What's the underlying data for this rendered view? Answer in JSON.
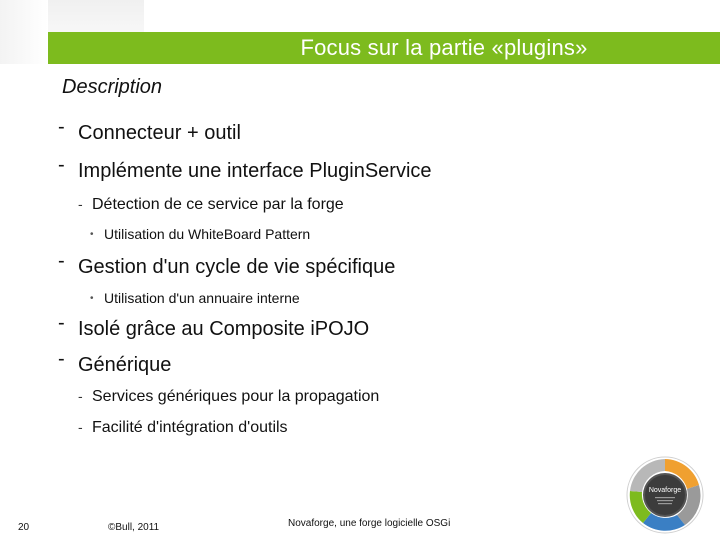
{
  "slide": {
    "title": "Focus sur la partie «plugins»",
    "section_label": "Description",
    "items": [
      {
        "level": 1,
        "marker": "-",
        "text": "Connecteur + outil"
      },
      {
        "level": 1,
        "marker": "-",
        "text": "Implémente une interface PluginService"
      },
      {
        "level": 2,
        "marker": "-",
        "text": "Détection de ce service par la forge"
      },
      {
        "level": 3,
        "marker": "•",
        "text": "Utilisation du WhiteBoard Pattern"
      },
      {
        "level": 1,
        "marker": "-",
        "text": "Gestion d'un cycle de vie spécifique"
      },
      {
        "level": 3,
        "marker": "•",
        "text": "Utilisation d'un annuaire interne"
      },
      {
        "level": 1,
        "marker": "-",
        "text": "Isolé grâce au Composite iPOJO"
      },
      {
        "level": 1,
        "marker": "-",
        "text": "Générique"
      },
      {
        "level": 2,
        "marker": "-",
        "text": "Services génériques pour la propagation"
      },
      {
        "level": 2,
        "marker": "-",
        "text": "Facilité d'intégration d'outils"
      }
    ]
  },
  "footer": {
    "page_number": "20",
    "copyright": "©Bull, 2011",
    "center_text": "Novaforge, une forge logicielle OSGi"
  },
  "logo": {
    "center_label": "Novaforge"
  },
  "colors": {
    "title_bar": "#7dbb1e",
    "logo_ring": "#8a8a8a"
  }
}
